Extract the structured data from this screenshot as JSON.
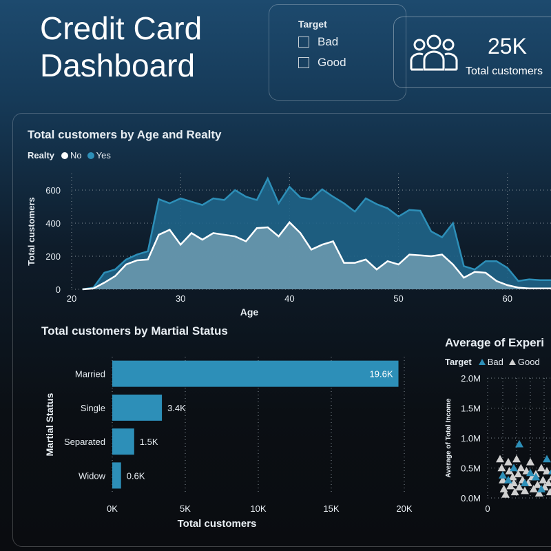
{
  "header": {
    "title_line1": "Credit Card",
    "title_line2": "Dashboard"
  },
  "target_filter": {
    "label": "Target",
    "options": [
      "Bad",
      "Good"
    ]
  },
  "kpi": {
    "value": "25K",
    "label": "Total customers",
    "icon": "people-group-icon"
  },
  "colors": {
    "yes": "#2d8fb8",
    "no": "#ffffff",
    "bar": "#2d8fb8",
    "bad": "#2d8fb8",
    "good": "#d0d0d0"
  },
  "chart_data": [
    {
      "type": "area",
      "title": "Total customers by Age and Realty",
      "legend_title": "Realty",
      "xlabel": "Age",
      "ylabel": "Total customers",
      "xlim": [
        20,
        64
      ],
      "ylim": [
        0,
        700
      ],
      "x_ticks": [
        20,
        30,
        40,
        50,
        60
      ],
      "y_ticks": [
        0,
        200,
        400,
        600
      ],
      "grid": true,
      "legend": "top-left",
      "x": [
        21,
        22,
        23,
        24,
        25,
        26,
        27,
        28,
        29,
        30,
        31,
        32,
        33,
        34,
        35,
        36,
        37,
        38,
        39,
        40,
        41,
        42,
        43,
        44,
        45,
        46,
        47,
        48,
        49,
        50,
        51,
        52,
        53,
        54,
        55,
        56,
        57,
        58,
        59,
        60,
        61,
        62,
        63,
        64
      ],
      "series": [
        {
          "name": "No",
          "values": [
            0,
            5,
            40,
            80,
            150,
            175,
            180,
            330,
            360,
            270,
            340,
            300,
            340,
            330,
            320,
            290,
            370,
            375,
            320,
            405,
            340,
            240,
            270,
            290,
            160,
            160,
            180,
            120,
            170,
            150,
            210,
            205,
            200,
            210,
            150,
            70,
            105,
            100,
            50,
            25,
            10,
            5,
            5,
            5
          ]
        },
        {
          "name": "Yes",
          "values": [
            0,
            10,
            100,
            120,
            180,
            210,
            230,
            545,
            520,
            550,
            530,
            510,
            550,
            540,
            600,
            560,
            540,
            670,
            520,
            620,
            555,
            545,
            605,
            560,
            520,
            470,
            550,
            515,
            490,
            440,
            480,
            475,
            350,
            315,
            400,
            140,
            120,
            170,
            170,
            130,
            50,
            60,
            55,
            55
          ]
        }
      ]
    },
    {
      "type": "bar",
      "orientation": "horizontal",
      "title": "Total customers by Martial Status",
      "xlabel": "Total customers",
      "ylabel": "Martial Status",
      "categories": [
        "Married",
        "Single",
        "Separated",
        "Widow"
      ],
      "values": [
        19600,
        3400,
        1500,
        600
      ],
      "data_labels": [
        "19.6K",
        "3.4K",
        "1.5K",
        "0.6K"
      ],
      "xlim": [
        0,
        20000
      ],
      "x_ticks": [
        "0K",
        "5K",
        "10K",
        "15K",
        "20K"
      ],
      "grid": true
    },
    {
      "type": "scatter",
      "title": "Average of Experi",
      "legend_title": "Target",
      "ylabel": "Average of Total Income",
      "y_ticks": [
        "0.0M",
        "0.5M",
        "1.0M",
        "1.5M",
        "2.0M"
      ],
      "x_ticks": [
        "0"
      ],
      "ylim": [
        0,
        2000000
      ],
      "series": [
        {
          "name": "Bad",
          "points": [
            [
              1,
              380000
            ],
            [
              2,
              300000
            ],
            [
              3,
              500000
            ],
            [
              4,
              900000
            ],
            [
              5,
              250000
            ],
            [
              6,
              420000
            ],
            [
              7,
              350000
            ],
            [
              8,
              150000
            ],
            [
              9,
              650000
            ],
            [
              10,
              450000
            ]
          ]
        },
        {
          "name": "Good",
          "points": [
            [
              0.5,
              650000
            ],
            [
              0.8,
              500000
            ],
            [
              1,
              300000
            ],
            [
              1.2,
              150000
            ],
            [
              1.5,
              60000
            ],
            [
              2,
              600000
            ],
            [
              2.2,
              450000
            ],
            [
              2.4,
              200000
            ],
            [
              2.8,
              350000
            ],
            [
              3,
              250000
            ],
            [
              3.2,
              100000
            ],
            [
              3.5,
              650000
            ],
            [
              3.8,
              400000
            ],
            [
              4,
              180000
            ],
            [
              4.3,
              500000
            ],
            [
              4.6,
              300000
            ],
            [
              5,
              120000
            ],
            [
              5.3,
              450000
            ],
            [
              5.6,
              250000
            ],
            [
              6,
              600000
            ],
            [
              6.3,
              350000
            ],
            [
              6.6,
              150000
            ],
            [
              7,
              400000
            ],
            [
              7.3,
              220000
            ],
            [
              7.6,
              80000
            ],
            [
              8,
              500000
            ],
            [
              8.3,
              300000
            ],
            [
              8.6,
              180000
            ],
            [
              9,
              450000
            ],
            [
              9.3,
              250000
            ],
            [
              9.6,
              100000
            ],
            [
              10,
              350000
            ]
          ]
        }
      ]
    }
  ]
}
